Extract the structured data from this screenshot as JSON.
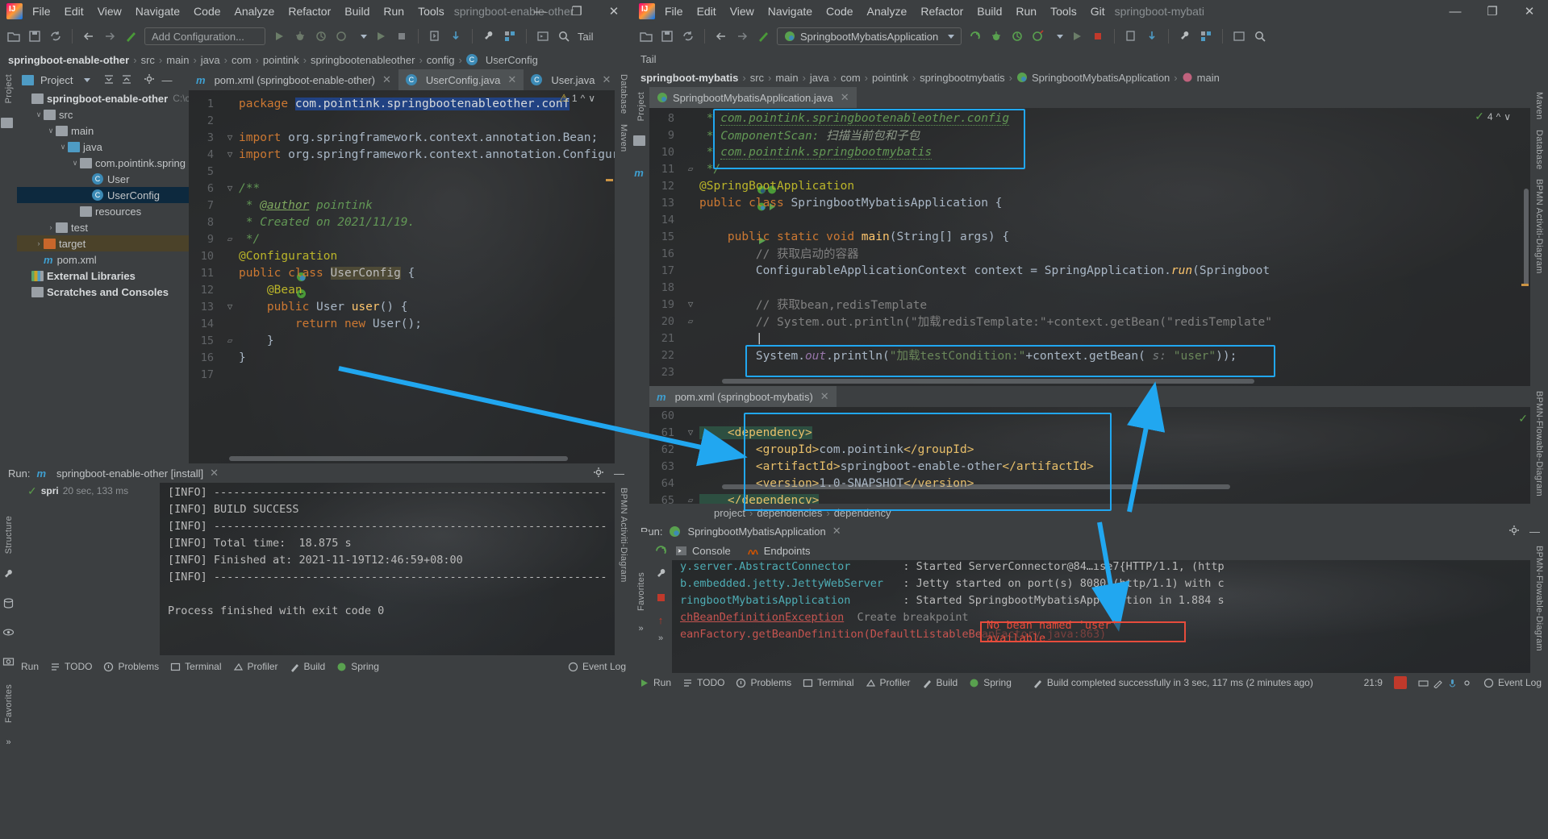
{
  "left_window": {
    "title_project": "springboot-enable-other",
    "menu": [
      "File",
      "Edit",
      "View",
      "Navigate",
      "Code",
      "Analyze",
      "Refactor",
      "Build",
      "Run",
      "Tools"
    ],
    "window_controls": [
      "—",
      "❐",
      "✕"
    ],
    "toolbar": {
      "run_config_label": "Add Configuration...",
      "icons": [
        "open-project-icon",
        "save-all-icon",
        "sync-icon",
        "back-icon",
        "forward-icon",
        "build-icon",
        "run-icon",
        "debug-icon",
        "coverage-icon",
        "profile-icon",
        "run2-icon",
        "stop-icon",
        "install-icon",
        "update-icon",
        "settings-wrench-icon",
        "structure-icon",
        "terminal-icon"
      ],
      "search_label": "Tail"
    },
    "breadcrumb": [
      "springboot-enable-other",
      "src",
      "main",
      "java",
      "com",
      "pointink",
      "springbootenableother",
      "config",
      "UserConfig"
    ],
    "tool_strip": [
      "Project",
      "Structure",
      "Favorites"
    ],
    "right_strip": [
      "Database",
      "Maven",
      "BPMN Activiti-Diagram",
      "BPMN-Flowable-Diagram"
    ],
    "project_panel": {
      "title": "Project",
      "tree": [
        {
          "label": "springboot-enable-other",
          "path": "C:\\cr",
          "depth": 0,
          "icon": "module-icon",
          "arrow": "",
          "state": "normal"
        },
        {
          "label": "src",
          "depth": 1,
          "icon": "folder-gray",
          "arrow": "∨",
          "state": "normal"
        },
        {
          "label": "main",
          "depth": 2,
          "icon": "folder-gray",
          "arrow": "∨",
          "state": "normal"
        },
        {
          "label": "java",
          "depth": 3,
          "icon": "folder-blue",
          "arrow": "∨",
          "state": "normal"
        },
        {
          "label": "com.pointink.spring",
          "depth": 4,
          "icon": "package-icon",
          "arrow": "∨",
          "state": "normal"
        },
        {
          "label": "User",
          "depth": 5,
          "icon": "class-icon",
          "arrow": "",
          "state": "normal"
        },
        {
          "label": "UserConfig",
          "depth": 5,
          "icon": "class-icon",
          "arrow": "",
          "state": "selected"
        },
        {
          "label": "resources",
          "depth": 4,
          "icon": "resources-icon",
          "arrow": "",
          "state": "normal"
        },
        {
          "label": "test",
          "depth": 2,
          "icon": "folder-gray",
          "arrow": "›",
          "state": "normal"
        },
        {
          "label": "target",
          "depth": 1,
          "icon": "folder-orange",
          "arrow": "›",
          "state": "highlighted"
        },
        {
          "label": "pom.xml",
          "depth": 1,
          "icon": "maven-icon",
          "arrow": "",
          "state": "normal"
        },
        {
          "label": "External Libraries",
          "depth": 0,
          "icon": "libraries-icon",
          "arrow": "",
          "state": "normal"
        },
        {
          "label": "Scratches and Consoles",
          "depth": 0,
          "icon": "scratches-icon",
          "arrow": "",
          "state": "normal"
        }
      ]
    },
    "editor": {
      "tabs": [
        {
          "label": "pom.xml (springboot-enable-other)",
          "icon": "maven-icon",
          "active": false
        },
        {
          "label": "UserConfig.java",
          "icon": "class-icon",
          "active": true
        },
        {
          "label": "User.java",
          "icon": "class-icon",
          "active": false
        }
      ],
      "inspection_count": "1",
      "lines": [
        {
          "n": "1",
          "content": "package com.pointink.springbootenableother.conf"
        },
        {
          "n": "2",
          "content": ""
        },
        {
          "n": "3",
          "content": "import org.springframework.context.annotation.Bean;"
        },
        {
          "n": "4",
          "content": "import org.springframework.context.annotation.Configurati"
        },
        {
          "n": "5",
          "content": ""
        },
        {
          "n": "6",
          "content": "/**"
        },
        {
          "n": "7",
          "content": " * @author pointink"
        },
        {
          "n": "8",
          "content": " * Created on 2021/11/19."
        },
        {
          "n": "9",
          "content": " */"
        },
        {
          "n": "10",
          "content": "@Configuration"
        },
        {
          "n": "11",
          "content": "public class UserConfig {"
        },
        {
          "n": "12",
          "content": "    @Bean"
        },
        {
          "n": "13",
          "content": "    public User user() {"
        },
        {
          "n": "14",
          "content": "        return new User();"
        },
        {
          "n": "15",
          "content": "    }"
        },
        {
          "n": "16",
          "content": "}"
        },
        {
          "n": "17",
          "content": ""
        }
      ]
    },
    "run_panel": {
      "label": "Run:",
      "tab": "springboot-enable-other [install]",
      "tree_item": "spri",
      "tree_time": "20 sec, 133 ms",
      "console": [
        "[INFO] ------------------------------------------------------------",
        "[INFO] BUILD SUCCESS",
        "[INFO] ------------------------------------------------------------",
        "[INFO] Total time:  18.875 s",
        "[INFO] Finished at: 2021-11-19T12:46:59+08:00",
        "[INFO] ------------------------------------------------------------",
        "",
        "Process finished with exit code 0"
      ]
    },
    "status_tabs": [
      "Run",
      "TODO",
      "Problems",
      "Terminal",
      "Profiler",
      "Build",
      "Spring"
    ],
    "status_right": [
      "Event Log"
    ]
  },
  "right_window": {
    "title_project": "springboot-mybati",
    "menu": [
      "File",
      "Edit",
      "View",
      "Navigate",
      "Code",
      "Analyze",
      "Refactor",
      "Build",
      "Run",
      "Tools",
      "Git"
    ],
    "window_controls": [
      "—",
      "❐",
      "✕"
    ],
    "toolbar": {
      "run_config_label": "SpringbootMybatisApplication",
      "tail_label": "Tail"
    },
    "breadcrumb": [
      "springboot-mybatis",
      "src",
      "main",
      "java",
      "com",
      "pointink",
      "springbootmybatis",
      "SpringbootMybatisApplication",
      "main"
    ],
    "editor": {
      "tabs": [
        {
          "label": "SpringbootMybatisApplication.java",
          "icon": "spring-class-icon",
          "active": true
        }
      ],
      "inspection_count": "4",
      "lines": [
        {
          "n": "8",
          "content": " * com.pointink.springbootenableother.config"
        },
        {
          "n": "9",
          "content": " * ComponentScan: 扫描当前包和子包"
        },
        {
          "n": "10",
          "content": " * com.pointink.springbootmybatis"
        },
        {
          "n": "11",
          "content": " */"
        },
        {
          "n": "12",
          "content": "@SpringBootApplication"
        },
        {
          "n": "13",
          "content": "public class SpringbootMybatisApplication {"
        },
        {
          "n": "14",
          "content": ""
        },
        {
          "n": "15",
          "content": "    public static void main(String[] args) {"
        },
        {
          "n": "16",
          "content": "        // 获取启动的容器"
        },
        {
          "n": "17",
          "content": "        ConfigurableApplicationContext context = SpringApplication.run(Springboot"
        },
        {
          "n": "18",
          "content": ""
        },
        {
          "n": "19",
          "content": "        // 获取bean,redisTemplate"
        },
        {
          "n": "20",
          "content": "        // System.out.println(\"加载redisTemplate:\"+context.getBean(\"redisTemplate\""
        },
        {
          "n": "21",
          "content": ""
        },
        {
          "n": "22",
          "content": "        System.out.println(\"加载testCondition:\"+context.getBean( s: \"user\"));"
        },
        {
          "n": "23",
          "content": ""
        }
      ]
    },
    "pom_editor": {
      "tab": "pom.xml (springboot-mybatis)",
      "lines": [
        {
          "n": "60",
          "content": ""
        },
        {
          "n": "61",
          "content": "    <dependency>"
        },
        {
          "n": "62",
          "content": "        <groupId>com.pointink</groupId>"
        },
        {
          "n": "63",
          "content": "        <artifactId>springboot-enable-other</artifactId>"
        },
        {
          "n": "64",
          "content": "        <version>1.0-SNAPSHOT</version>"
        },
        {
          "n": "65",
          "content": "    </dependency>"
        }
      ],
      "breadcrumb": [
        "project",
        "dependencies",
        "dependency"
      ]
    },
    "run_panel": {
      "label": "Run:",
      "tab": "SpringbootMybatisApplication",
      "sub_tabs": [
        "Console",
        "Endpoints"
      ],
      "console": [
        {
          "logger": "y.server.AbstractConnector",
          "sep": ":",
          "msg": "Started ServerConnector@84…ıse7{HTTP/1.1, (http"
        },
        {
          "logger": "b.embedded.jetty.JettyWebServer",
          "sep": ":",
          "msg": "Jetty started on port(s) 8080 (http/1.1) with c"
        },
        {
          "logger": "ringbootMybatisApplication",
          "sep": ":",
          "msg": "Started SpringbootMybatisApplication in 1.884 s"
        },
        {
          "logger": "chBeanDefinitionException",
          "sep": "",
          "msg": "Create breakpoint"
        },
        {
          "logger": "eanFactory.getBeanDefinition(DefaultListableBeanFactory.java:863)",
          "sep": "",
          "msg": ""
        }
      ],
      "error_badge": "No bean named 'user' available"
    },
    "status_tabs": [
      "Run",
      "TODO",
      "Problems",
      "Terminal",
      "Profiler",
      "Build",
      "Spring"
    ],
    "status_message": "Build completed successfully in 3 sec, 117 ms (2 minutes ago)",
    "caret_position": "21:9",
    "status_right": [
      "Event Log"
    ],
    "right_strip": [
      "Maven",
      "Database",
      "BPMN Activiti-Diagram",
      "BPMN-Flowable-Diagram"
    ]
  },
  "annotations": {
    "accent_color": "#21a7f0",
    "error_color": "#e74c3c",
    "boxes": [
      "javadoc-package-scan-box",
      "system-out-println-box",
      "pom-dependency-box"
    ],
    "arrows": [
      "userconfig-to-pom-dependency",
      "pom-dependency-to-println",
      "println-to-error-badge"
    ]
  }
}
